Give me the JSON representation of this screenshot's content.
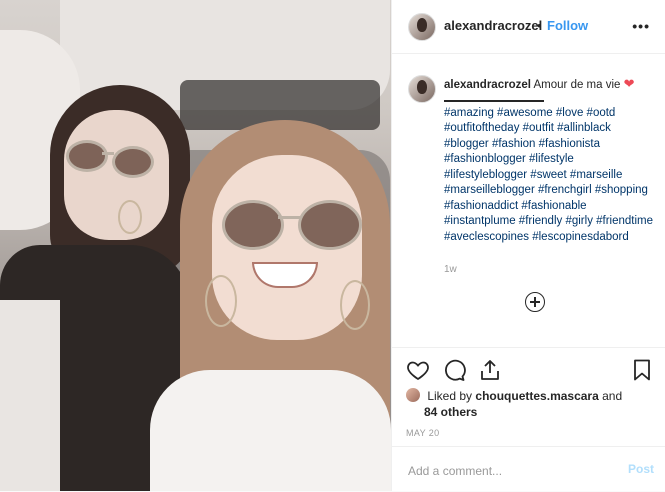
{
  "post": {
    "username": "alexandracrozel",
    "follow_label": "Follow",
    "separator": "•",
    "more_label": "•••"
  },
  "caption": {
    "username": "alexandracrozel",
    "text": "Amour de ma vie",
    "heart": "❤",
    "hashtags": "#amazing #awesome #love #ootd #outfitoftheday #outfit #allinblack #blogger #fashion #fashionista #fashionblogger #lifestyle #lifestyleblogger #sweet #marseille #marseilleblogger #frenchgirl #shopping #fashionaddict #fashionable #instantplume #friendly #girly #friendtime #aveclescopines #lescopinesdabord",
    "time_ago": "1w"
  },
  "actions": {
    "icons": [
      "heart-outline-icon",
      "comment-icon",
      "share-icon",
      "bookmark-icon"
    ]
  },
  "likes": {
    "prefix": "Liked by",
    "user": "chouquettes.mascara",
    "connector": "and",
    "others": "84 others"
  },
  "date": "MAY 20",
  "comment": {
    "placeholder": "Add a comment...",
    "post_label": "Post"
  },
  "colors": {
    "link": "#3897f0",
    "hashtag": "#003569",
    "heart": "#ed4956",
    "post_disabled": "#b2dffc"
  }
}
